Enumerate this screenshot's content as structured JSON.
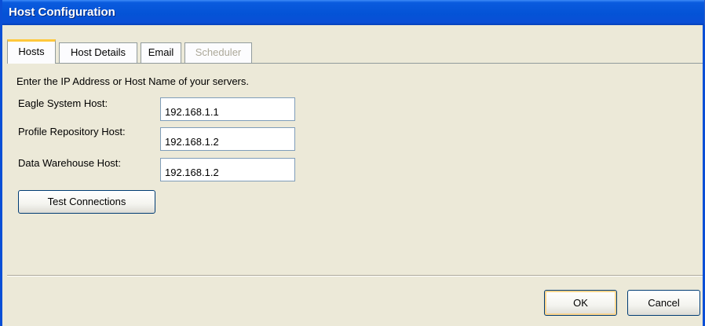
{
  "window": {
    "title": "Host Configuration"
  },
  "tabs": [
    {
      "label": "Hosts",
      "state": "active"
    },
    {
      "label": "Host Details",
      "state": "normal"
    },
    {
      "label": "Email",
      "state": "normal"
    },
    {
      "label": "Scheduler",
      "state": "disabled"
    }
  ],
  "hosts": {
    "instructions": "Enter the IP Address or Host Name of your servers.",
    "fields": [
      {
        "label": "Eagle System Host:",
        "value": "192.168.1.1"
      },
      {
        "label": "Profile Repository Host:",
        "value": "192.168.1.2"
      },
      {
        "label": "Data Warehouse Host:",
        "value": "192.168.1.2"
      }
    ],
    "test_button": "Test Connections"
  },
  "footer": {
    "ok_label": "OK",
    "cancel_label": "Cancel"
  },
  "colors": {
    "titlebar": "#0a4fd6",
    "background": "#ece9d8",
    "active_tab_accent": "#ffc83c",
    "disabled_text": "#aca899"
  }
}
